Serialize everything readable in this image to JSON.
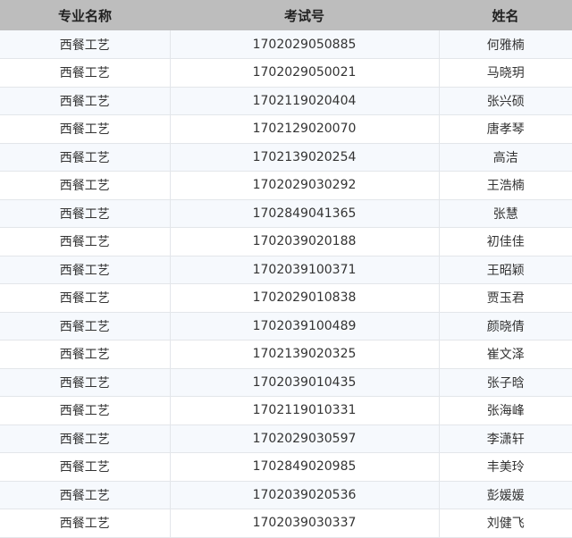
{
  "table": {
    "headers": [
      "专业名称",
      "考试号",
      "姓名"
    ],
    "rows": [
      [
        "西餐工艺",
        "1702029050885",
        "何雅楠"
      ],
      [
        "西餐工艺",
        "1702029050021",
        "马晓玥"
      ],
      [
        "西餐工艺",
        "1702119020404",
        "张兴硕"
      ],
      [
        "西餐工艺",
        "1702129020070",
        "唐孝琴"
      ],
      [
        "西餐工艺",
        "1702139020254",
        "高洁"
      ],
      [
        "西餐工艺",
        "1702029030292",
        "王浩楠"
      ],
      [
        "西餐工艺",
        "1702849041365",
        "张慧"
      ],
      [
        "西餐工艺",
        "1702039020188",
        "初佳佳"
      ],
      [
        "西餐工艺",
        "1702039100371",
        "王昭颖"
      ],
      [
        "西餐工艺",
        "1702029010838",
        "贾玉君"
      ],
      [
        "西餐工艺",
        "1702039100489",
        "颜晓倩"
      ],
      [
        "西餐工艺",
        "1702139020325",
        "崔文泽"
      ],
      [
        "西餐工艺",
        "1702039010435",
        "张子晗"
      ],
      [
        "西餐工艺",
        "1702119010331",
        "张海峰"
      ],
      [
        "西餐工艺",
        "1702029030597",
        "李潇轩"
      ],
      [
        "西餐工艺",
        "1702849020985",
        "丰美玲"
      ],
      [
        "西餐工艺",
        "1702039020536",
        "彭媛媛"
      ],
      [
        "西餐工艺",
        "1702039030337",
        "刘健飞"
      ]
    ]
  }
}
